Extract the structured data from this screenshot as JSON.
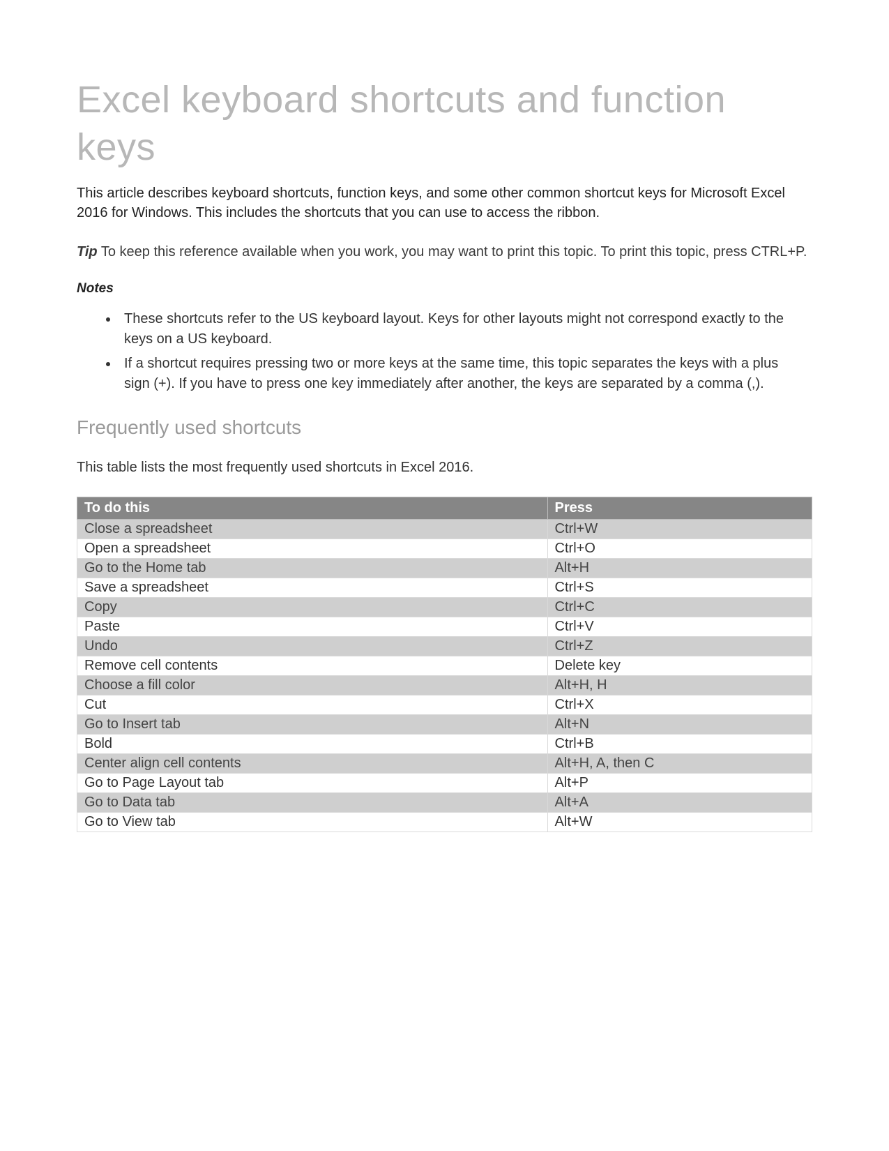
{
  "title": "Excel keyboard shortcuts and function keys",
  "intro": "This article describes keyboard shortcuts, function keys, and some other common shortcut keys for Microsoft Excel 2016 for Windows. This includes the shortcuts that you can use to access the ribbon.",
  "tip_label": "Tip",
  "tip_text": "  To keep this reference available when you work, you may want to print this topic. To print this topic, press CTRL+P.",
  "notes_label": "Notes",
  "notes": [
    "These shortcuts refer to the US keyboard layout. Keys for other layouts might not correspond exactly to the keys on a US keyboard.",
    "If a shortcut requires pressing two or more keys at the same time, this topic separates the keys with a plus sign (+). If you have to press one key immediately after another, the keys are separated by a comma (,)."
  ],
  "section_heading": "Frequently used shortcuts",
  "table_intro": "This table lists the most frequently used shortcuts in Excel 2016.",
  "table": {
    "headers": {
      "action": "To do this",
      "key": "Press"
    },
    "rows": [
      {
        "action": "Close a spreadsheet",
        "key": "Ctrl+W"
      },
      {
        "action": "Open a spreadsheet",
        "key": "Ctrl+O"
      },
      {
        "action": "Go to the Home tab",
        "key": "Alt+H"
      },
      {
        "action": "Save a spreadsheet",
        "key": "Ctrl+S"
      },
      {
        "action": "Copy",
        "key": "Ctrl+C"
      },
      {
        "action": "Paste",
        "key": "Ctrl+V"
      },
      {
        "action": "Undo",
        "key": "Ctrl+Z"
      },
      {
        "action": "Remove cell contents",
        "key": "Delete key"
      },
      {
        "action": "Choose a fill color",
        "key": "Alt+H, H"
      },
      {
        "action": "Cut",
        "key": "Ctrl+X"
      },
      {
        "action": "Go to Insert tab",
        "key": "Alt+N"
      },
      {
        "action": "Bold",
        "key": "Ctrl+B"
      },
      {
        "action": "Center align cell contents",
        "key": "Alt+H, A, then C"
      },
      {
        "action": "Go to Page Layout tab",
        "key": "Alt+P"
      },
      {
        "action": "Go to Data tab",
        "key": "Alt+A"
      },
      {
        "action": "Go to View tab",
        "key": "Alt+W"
      }
    ]
  }
}
